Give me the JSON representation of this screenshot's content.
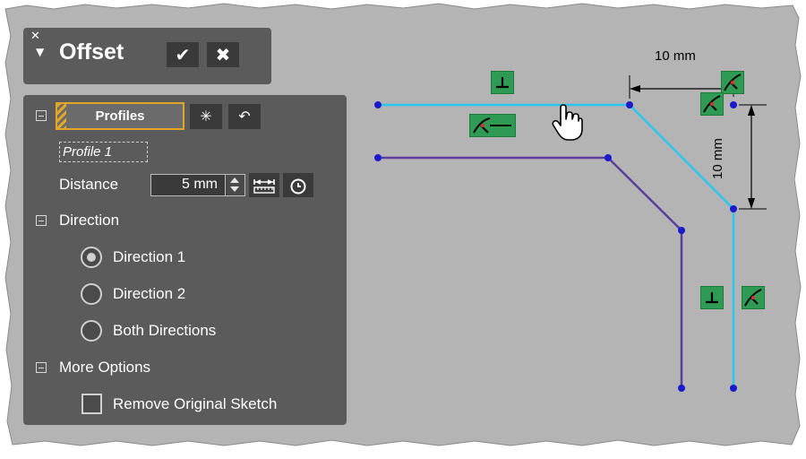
{
  "panel": {
    "title": "Offset",
    "pin_icon": "pin-icon",
    "ok_icon": "checkmark-icon",
    "cancel_icon": "close-icon",
    "profiles": {
      "button_label": "Profiles",
      "items": [
        "Profile 1"
      ]
    },
    "distance": {
      "label": "Distance",
      "value": "5 mm"
    },
    "direction": {
      "section_label": "Direction",
      "options": [
        {
          "label": "Direction 1",
          "selected": true
        },
        {
          "label": "Direction 2",
          "selected": false
        },
        {
          "label": "Both Directions",
          "selected": false
        }
      ]
    },
    "more_options": {
      "section_label": "More Options",
      "remove_original_label": "Remove Original Sketch",
      "remove_original_checked": false
    }
  },
  "sketch": {
    "dimension_horizontal": "10 mm",
    "dimension_vertical": "10 mm",
    "colors": {
      "background": "#b4b4b4",
      "offset_line": "#29c6f0",
      "original_line": "#5c3f9c",
      "constraint_green": "#2e9a54"
    },
    "constraint_icons": [
      "perpendicular-constraint-icon",
      "tangent-constraint-icon"
    ]
  }
}
